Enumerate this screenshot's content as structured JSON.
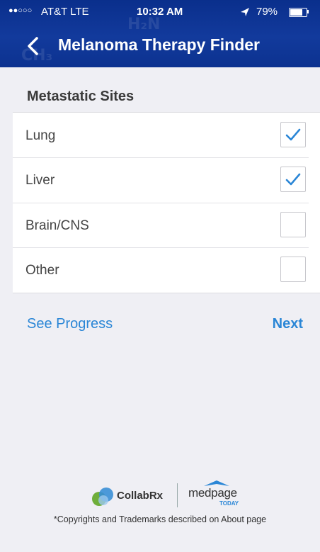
{
  "status_bar": {
    "signal": "●●○○○",
    "carrier": "AT&T  LTE",
    "time": "10:32 AM",
    "icons": "⇗ ◉ ∗",
    "battery": "79%",
    "battery_level": 0.79
  },
  "nav": {
    "title": "Melanoma Therapy Finder"
  },
  "section": {
    "title": "Metastatic Sites"
  },
  "options": [
    {
      "label": "Lung",
      "checked": true
    },
    {
      "label": "Liver",
      "checked": true
    },
    {
      "label": "Brain/CNS",
      "checked": false
    },
    {
      "label": "Other",
      "checked": false
    }
  ],
  "footer": {
    "see_progress": "See Progress",
    "next": "Next"
  },
  "logos": {
    "collabrx": "CollabRx",
    "medpage": "medpage",
    "medpage_sub": "TODAY"
  },
  "copyright": "*Copyrights and Trademarks described on About page",
  "colors": {
    "header": "#0c3290",
    "accent": "#2a86d6",
    "background": "#efeff4"
  }
}
